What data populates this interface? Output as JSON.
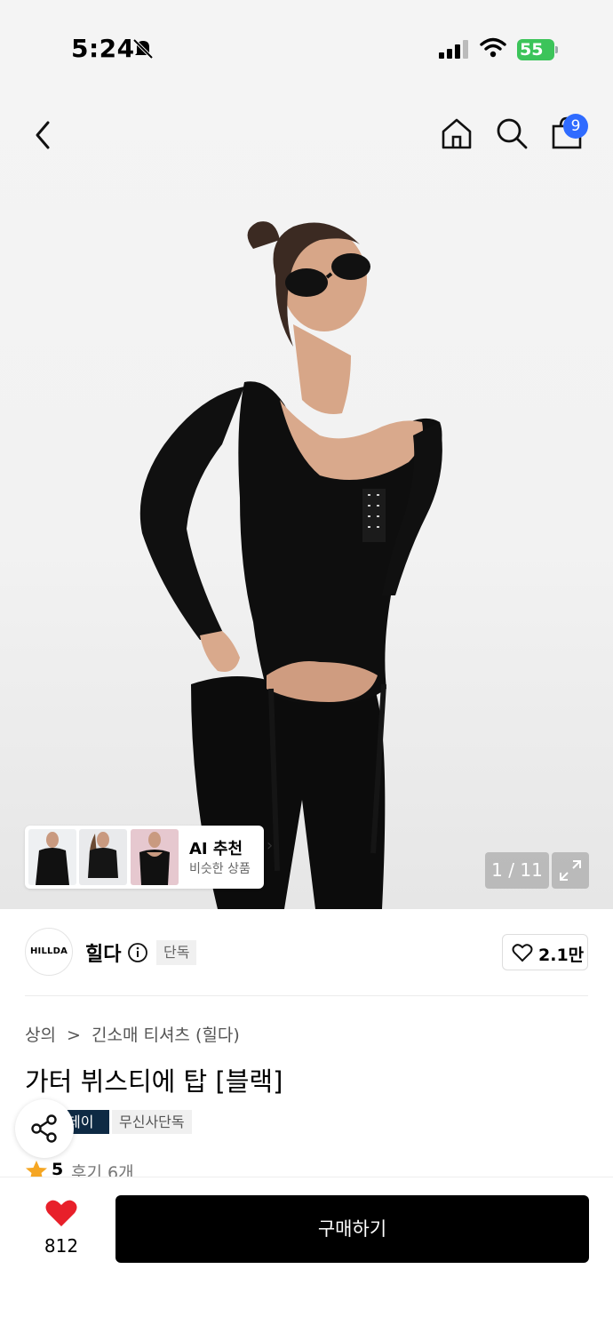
{
  "status_bar": {
    "time": "5:24",
    "battery": "55"
  },
  "nav": {
    "cart_count": "9"
  },
  "gallery": {
    "counter": "1 / 11"
  },
  "ai_recommend": {
    "title": "AI 추천",
    "subtitle": "비슷한 상품"
  },
  "brand": {
    "logo_text": "HILLDA",
    "name": "힐다",
    "exclusive_tag": "단독",
    "like_count": "2.1만"
  },
  "breadcrumb": {
    "category": "상의",
    "separator": ">",
    "subcategory": "긴소매 티셔츠 (힐다)"
  },
  "product": {
    "title": "가터 뷔스티에 탑 [블랙]"
  },
  "tags": {
    "dark": "데이",
    "light": "무신사단독"
  },
  "rating": {
    "score": "5",
    "review_label": "후기 6개"
  },
  "bottom": {
    "wish_count": "812",
    "buy_label": "구매하기"
  },
  "colors": {
    "accent_blue": "#2f6bff",
    "heart_red": "#e8202a",
    "tag_navy": "#0e2a44",
    "battery_green": "#3cc45a"
  }
}
